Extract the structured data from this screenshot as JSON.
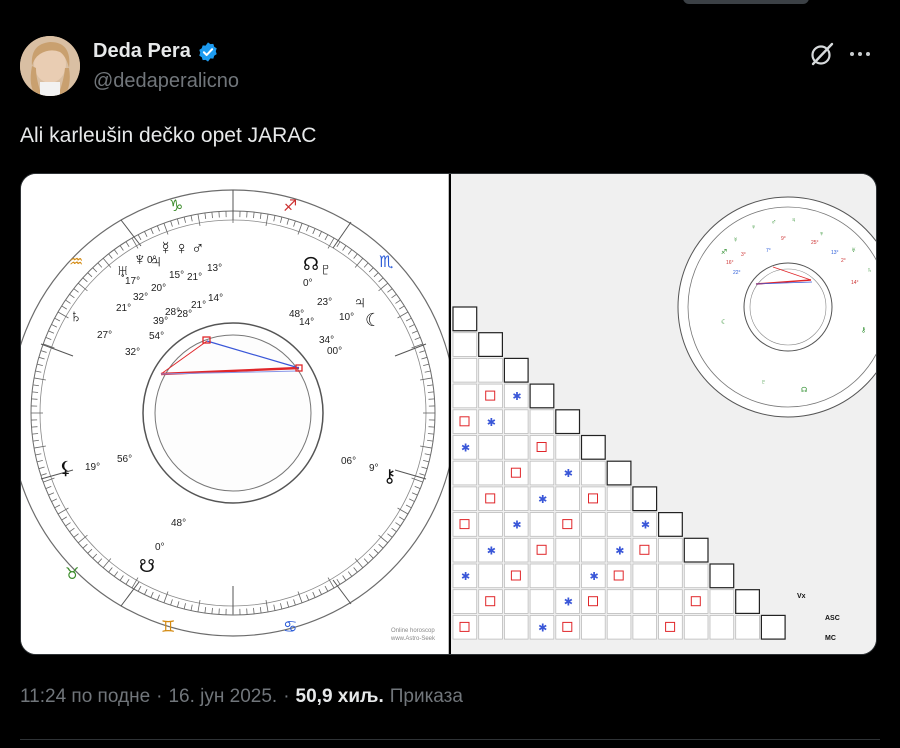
{
  "tweet": {
    "author_name": "Deda Pera",
    "handle": "@dedaperalicno",
    "text": "Ali karleušin dečko opet JARAC",
    "time": "11:24 по подне",
    "date": "16. јун 2025.",
    "separator": "·",
    "views_count": "50,9 хиљ.",
    "views_label": "Приказа"
  },
  "icons": {
    "verified": "verified-badge-icon",
    "grok": "grok-icon",
    "more": "more-icon"
  },
  "chart_image": {
    "degrees": [
      "0°",
      "27°",
      "32°",
      "20°",
      "17°",
      "15°",
      "21°",
      "13°",
      "21°",
      "25°",
      "28°",
      "54°",
      "21°",
      "14°",
      "39°",
      "28°",
      "23°",
      "48°",
      "14°",
      "10°",
      "34°",
      "00°",
      "19°",
      "56°",
      "06°",
      "9°",
      "48°",
      "0°"
    ],
    "grid_labels": [
      "ASC",
      "MC",
      "Vx"
    ],
    "watermark_1": "Online horoscop",
    "watermark_2": "www.Astro-Seek"
  },
  "colors": {
    "bg": "#000000",
    "text": "#e7e9ea",
    "muted": "#71767b",
    "verified": "#1d9bf0",
    "aspect_red": "#e0262a",
    "aspect_blue": "#3a57d8"
  }
}
